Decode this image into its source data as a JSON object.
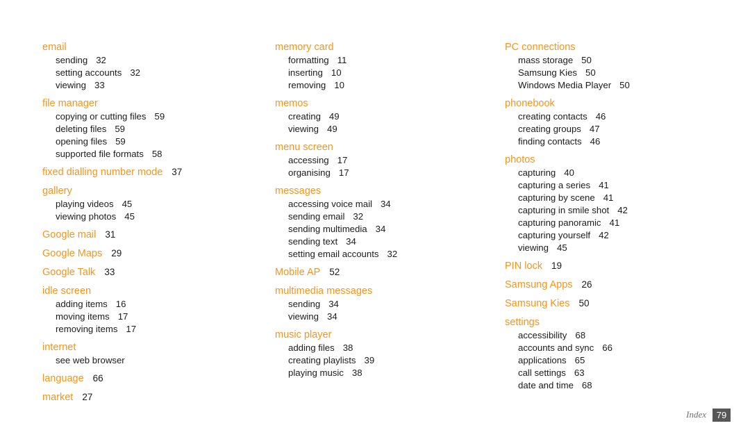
{
  "document": {
    "page_kind": "index",
    "accent_color": "#f7941e",
    "text_color": "#1c1a1a"
  },
  "footer": {
    "label": "Index",
    "page_number": "79",
    "box_color": "#575757"
  },
  "columns": [
    {
      "id": "column-1",
      "groups": [
        {
          "heading": "email",
          "heading_page": "",
          "entries": [
            {
              "label": "sending",
              "page": "32"
            },
            {
              "label": "setting accounts",
              "page": "32"
            },
            {
              "label": "viewing",
              "page": "33"
            }
          ]
        },
        {
          "heading": "file manager",
          "heading_page": "",
          "entries": [
            {
              "label": "copying or cutting files",
              "page": "59"
            },
            {
              "label": "deleting files",
              "page": "59"
            },
            {
              "label": "opening files",
              "page": "59"
            },
            {
              "label": "supported file formats",
              "page": "58"
            }
          ]
        },
        {
          "heading": "fixed dialling number mode",
          "heading_page": "37",
          "entries": []
        },
        {
          "heading": "gallery",
          "heading_page": "",
          "entries": [
            {
              "label": "playing videos",
              "page": "45"
            },
            {
              "label": "viewing photos",
              "page": "45"
            }
          ]
        },
        {
          "heading": "Google mail",
          "heading_page": "31",
          "entries": []
        },
        {
          "heading": "Google Maps",
          "heading_page": "29",
          "entries": []
        },
        {
          "heading": "Google Talk",
          "heading_page": "33",
          "entries": []
        },
        {
          "heading": "idle screen",
          "heading_page": "",
          "entries": [
            {
              "label": "adding items",
              "page": "16"
            },
            {
              "label": "moving items",
              "page": "17"
            },
            {
              "label": "removing items",
              "page": "17"
            }
          ]
        },
        {
          "heading": "internet",
          "heading_page": "",
          "entries": [
            {
              "label": "see web browser",
              "page": ""
            }
          ]
        },
        {
          "heading": "language",
          "heading_page": "66",
          "entries": []
        },
        {
          "heading": "market",
          "heading_page": "27",
          "entries": []
        }
      ]
    },
    {
      "id": "column-2",
      "groups": [
        {
          "heading": "memory card",
          "heading_page": "",
          "entries": [
            {
              "label": "formatting",
              "page": "11"
            },
            {
              "label": "inserting",
              "page": "10"
            },
            {
              "label": "removing",
              "page": "10"
            }
          ]
        },
        {
          "heading": "memos",
          "heading_page": "",
          "entries": [
            {
              "label": "creating",
              "page": "49"
            },
            {
              "label": "viewing",
              "page": "49"
            }
          ]
        },
        {
          "heading": "menu screen",
          "heading_page": "",
          "entries": [
            {
              "label": "accessing",
              "page": "17"
            },
            {
              "label": "organising",
              "page": "17"
            }
          ]
        },
        {
          "heading": "messages",
          "heading_page": "",
          "entries": [
            {
              "label": "accessing voice mail",
              "page": "34"
            },
            {
              "label": "sending email",
              "page": "32"
            },
            {
              "label": "sending multimedia",
              "page": "34"
            },
            {
              "label": "sending text",
              "page": "34"
            },
            {
              "label": "setting email accounts",
              "page": "32"
            }
          ]
        },
        {
          "heading": "Mobile AP",
          "heading_page": "52",
          "entries": []
        },
        {
          "heading": "multimedia messages",
          "heading_page": "",
          "entries": [
            {
              "label": "sending",
              "page": "34"
            },
            {
              "label": "viewing",
              "page": "34"
            }
          ]
        },
        {
          "heading": "music player",
          "heading_page": "",
          "entries": [
            {
              "label": "adding files",
              "page": "38"
            },
            {
              "label": "creating playlists",
              "page": "39"
            },
            {
              "label": "playing music",
              "page": "38"
            }
          ]
        }
      ]
    },
    {
      "id": "column-3",
      "groups": [
        {
          "heading": "PC connections",
          "heading_page": "",
          "entries": [
            {
              "label": "mass storage",
              "page": "50"
            },
            {
              "label": "Samsung Kies",
              "page": "50"
            },
            {
              "label": "Windows Media Player",
              "page": "50"
            }
          ]
        },
        {
          "heading": "phonebook",
          "heading_page": "",
          "entries": [
            {
              "label": "creating contacts",
              "page": "46"
            },
            {
              "label": "creating groups",
              "page": "47"
            },
            {
              "label": "finding contacts",
              "page": "46"
            }
          ]
        },
        {
          "heading": "photos",
          "heading_page": "",
          "entries": [
            {
              "label": "capturing",
              "page": "40"
            },
            {
              "label": "capturing a series",
              "page": "41"
            },
            {
              "label": "capturing by scene",
              "page": "41"
            },
            {
              "label": "capturing in smile shot",
              "page": "42"
            },
            {
              "label": "capturing panoramic",
              "page": "41"
            },
            {
              "label": "capturing yourself",
              "page": "42"
            },
            {
              "label": "viewing",
              "page": "45"
            }
          ]
        },
        {
          "heading": "PIN lock",
          "heading_page": "19",
          "entries": []
        },
        {
          "heading": "Samsung Apps",
          "heading_page": "26",
          "entries": []
        },
        {
          "heading": "Samsung Kies",
          "heading_page": "50",
          "entries": []
        },
        {
          "heading": "settings",
          "heading_page": "",
          "entries": [
            {
              "label": "accessibility",
              "page": "68"
            },
            {
              "label": "accounts and sync",
              "page": "66"
            },
            {
              "label": "applications",
              "page": "65"
            },
            {
              "label": "call settings",
              "page": "63"
            },
            {
              "label": "date and time",
              "page": "68"
            }
          ]
        }
      ]
    }
  ]
}
